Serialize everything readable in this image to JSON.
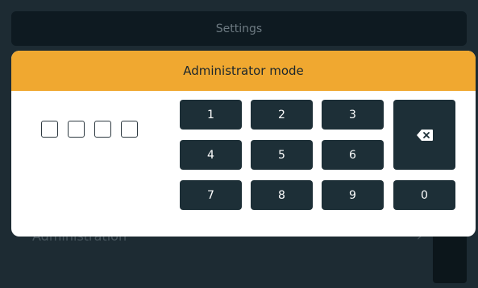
{
  "header": {
    "title": "Settings"
  },
  "background": {
    "row_label": "Administration",
    "row_chevron": "›"
  },
  "modal": {
    "title": "Administrator mode",
    "pin_length": 4,
    "keys": {
      "k1": "1",
      "k2": "2",
      "k3": "3",
      "k4": "4",
      "k5": "5",
      "k6": "6",
      "k7": "7",
      "k8": "8",
      "k9": "9",
      "k0": "0"
    },
    "backspace_icon": "backspace-icon"
  }
}
